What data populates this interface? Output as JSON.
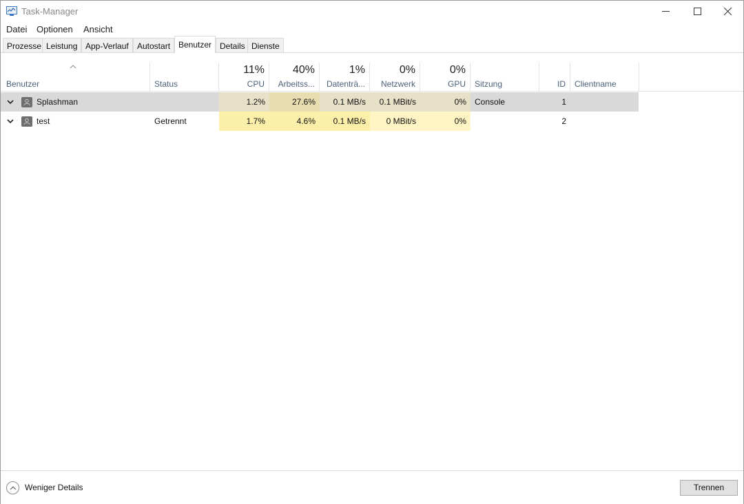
{
  "window": {
    "title": "Task-Manager"
  },
  "menu": [
    "Datei",
    "Optionen",
    "Ansicht"
  ],
  "tabs": [
    "Prozesse",
    "Leistung",
    "App-Verlauf",
    "Autostart",
    "Benutzer",
    "Details",
    "Dienste"
  ],
  "active_tab": "Benutzer",
  "columns": {
    "benutzer": {
      "label": "Benutzer"
    },
    "status": {
      "label": "Status"
    },
    "cpu": {
      "pct": "11%",
      "label": "CPU"
    },
    "mem": {
      "pct": "40%",
      "label": "Arbeitss..."
    },
    "disk": {
      "pct": "1%",
      "label": "Datenträ..."
    },
    "net": {
      "pct": "0%",
      "label": "Netzwerk"
    },
    "gpu": {
      "pct": "0%",
      "label": "GPU"
    },
    "sitzung": {
      "label": "Sitzung"
    },
    "id": {
      "label": "ID"
    },
    "client": {
      "label": "Clientname"
    }
  },
  "rows": [
    {
      "name": "Splashman",
      "status": "",
      "cpu": "1.2%",
      "mem": "27.6%",
      "disk": "0.1 MB/s",
      "net": "0.1 MBit/s",
      "gpu": "0%",
      "sitzung": "Console",
      "id": "1",
      "client": ""
    },
    {
      "name": "test",
      "status": "Getrennt",
      "cpu": "1.7%",
      "mem": "4.6%",
      "disk": "0.1 MB/s",
      "net": "0 MBit/s",
      "gpu": "0%",
      "sitzung": "",
      "id": "2",
      "client": ""
    }
  ],
  "footer": {
    "fewer_details": "Weniger Details",
    "disconnect": "Trennen"
  },
  "colors": {
    "heat_light": "#fff4c4",
    "heat_medium": "#f9eca8",
    "heat_mem": "#f8e49c",
    "selected_row": "#d9d9d9",
    "header_label": "#4c607a"
  }
}
